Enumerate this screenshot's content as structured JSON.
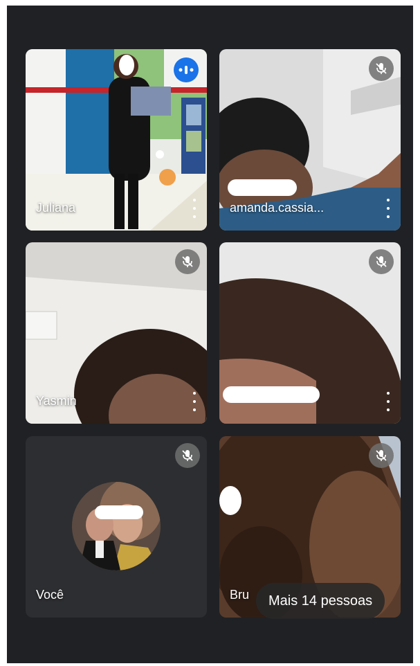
{
  "meeting": {
    "participants": [
      {
        "name": "Juliana",
        "status": "speaking",
        "status_icon": "speaking-indicator-icon"
      },
      {
        "name": "amanda.cassia...",
        "status": "muted",
        "status_icon": "mic-off-icon"
      },
      {
        "name": "Yasmin",
        "status": "muted",
        "status_icon": "mic-off-icon"
      },
      {
        "name": "",
        "status": "muted",
        "status_icon": "mic-off-icon"
      },
      {
        "name": "Você",
        "status": "muted",
        "status_icon": "mic-off-icon"
      },
      {
        "name": "Bru",
        "status": "muted",
        "status_icon": "mic-off-icon"
      }
    ],
    "more_people_label": "Mais 14 pessoas"
  },
  "colors": {
    "background": "#202124",
    "tile_background": "#3c4043",
    "speaking_indicator": "#1a73e8",
    "text": "#ffffff"
  }
}
